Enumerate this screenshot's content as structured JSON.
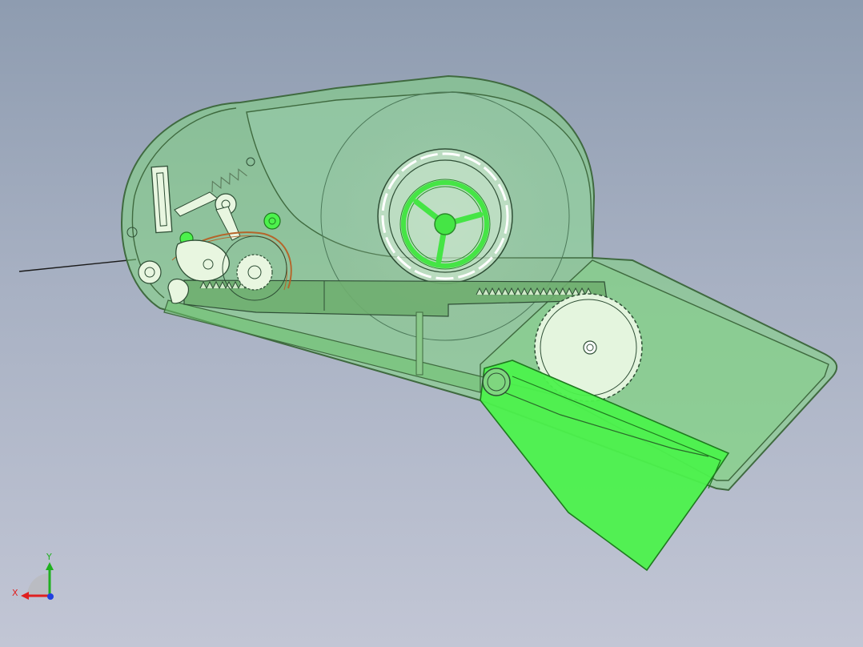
{
  "viewport": {
    "background_top": "#8e9cb0",
    "background_bottom": "#c2c6d5"
  },
  "model": {
    "shell_fill": "#7fd67f",
    "shell_stroke": "#3f6a3f",
    "highlight_part_fill": "#4cf24c",
    "gear_fill": "#dff5d8",
    "spring_color": "#b5652a"
  },
  "triad": {
    "x_label": "X",
    "y_label": "Y",
    "x_color": "#e02020",
    "y_color": "#20b020",
    "z_color": "#2040e0"
  }
}
